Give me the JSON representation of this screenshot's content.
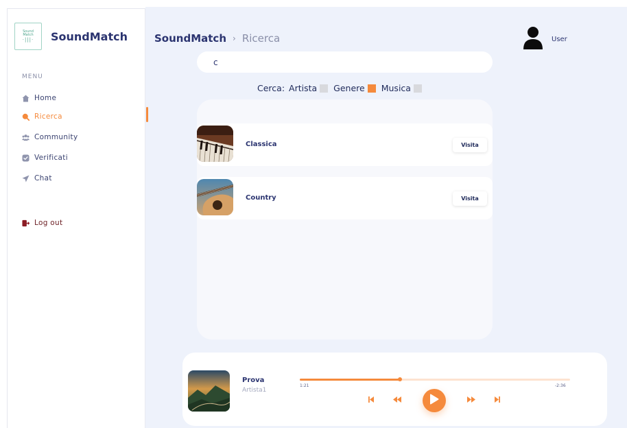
{
  "sidebar": {
    "logo_text_top": "Sound",
    "logo_text_mid": "Match",
    "logo_wave": "·|||·",
    "brand": "SoundMatch",
    "menu_title": "MENU",
    "items": [
      {
        "label": "Home",
        "icon": "home-icon"
      },
      {
        "label": "Ricerca",
        "icon": "search-icon"
      },
      {
        "label": "Community",
        "icon": "community-icon"
      },
      {
        "label": "Verificati",
        "icon": "verified-icon"
      },
      {
        "label": "Chat",
        "icon": "send-icon"
      }
    ],
    "logout": {
      "label": "Log out",
      "icon": "logout-icon"
    }
  },
  "header": {
    "app": "SoundMatch",
    "separator": "›",
    "page": "Ricerca",
    "user_label": "User"
  },
  "search": {
    "value": "c",
    "filter_label": "Cerca:",
    "filters": [
      {
        "label": "Artista",
        "checked": false
      },
      {
        "label": "Genere",
        "checked": true
      },
      {
        "label": "Musica",
        "checked": false
      }
    ]
  },
  "results": [
    {
      "name": "Classica",
      "button": "Visita",
      "thumb": "piano-image"
    },
    {
      "name": "Country",
      "button": "Visita",
      "thumb": "guitar-image"
    }
  ],
  "player": {
    "title": "Prova",
    "artist": "Artista1",
    "elapsed": "1:21",
    "remaining": "-2:36",
    "progress": 0.37
  },
  "colors": {
    "accent": "#f58a3c",
    "navy": "#2b3470",
    "background": "#eef2fb",
    "logout": "#6b1e23"
  }
}
